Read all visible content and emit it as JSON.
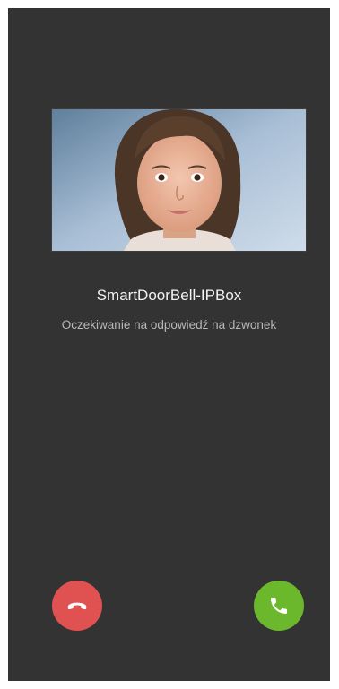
{
  "call": {
    "caller_name": "SmartDoorBell-IPBox",
    "status": "Oczekiwanie na odpowiedź na dzwonek"
  },
  "icons": {
    "decline": "phone-hangup-icon",
    "accept": "phone-answer-icon"
  },
  "colors": {
    "background": "#333333",
    "decline": "#e05252",
    "accept": "#6cb82c"
  }
}
